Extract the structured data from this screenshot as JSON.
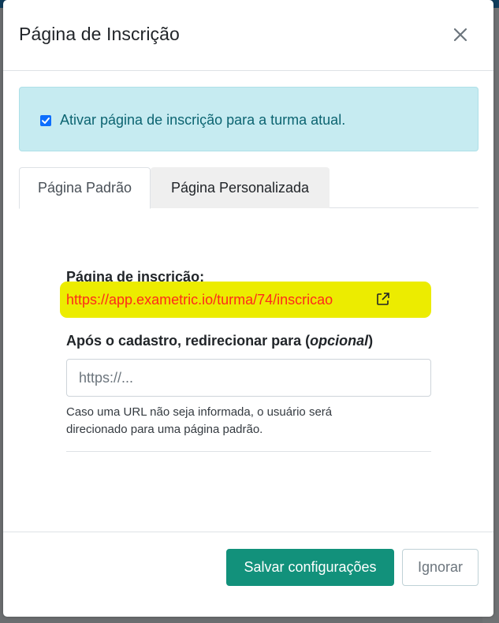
{
  "modal": {
    "title": "Página de Inscrição",
    "close_icon": "close-icon"
  },
  "alert": {
    "checkbox_checked": true,
    "label": "Ativar página de inscrição para a turma atual."
  },
  "tabs": [
    {
      "label": "Página Padrão",
      "active": true
    },
    {
      "label": "Página Personalizada",
      "active": false
    }
  ],
  "signup": {
    "label": "Página de inscrição:",
    "url": "https://app.exametric.io/turma/74/inscricao",
    "external_icon": "external-link-icon"
  },
  "redirect": {
    "label_main": "Após o cadastro, redirecionar para (",
    "label_optional": "opcional",
    "label_end": ")",
    "input_value": "",
    "input_placeholder": "https://...",
    "help_text": "Caso uma URL não seja informada, o usuário será direcionado para uma página padrão."
  },
  "footer": {
    "save_label": "Salvar configurações",
    "ignore_label": "Ignorar"
  },
  "colors": {
    "primary": "#12917b",
    "alert_bg": "#c6ebf1",
    "alert_text": "#0c6471",
    "link": "#ff2a1a",
    "highlight": "#ecec00"
  }
}
